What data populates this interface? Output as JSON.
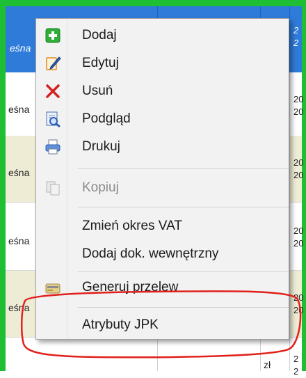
{
  "background": {
    "header_left_text": "eśna",
    "header_right_line1": "2",
    "header_right_line2": "2",
    "rows": [
      {
        "label": "eśna",
        "right1": "20",
        "right2": "20"
      },
      {
        "label": "eśna",
        "right1": "20",
        "right2": "20"
      },
      {
        "label": "eśna",
        "right1": "20",
        "right2": "20"
      },
      {
        "label": "eśna",
        "right1": "20",
        "right2": "20"
      }
    ],
    "bottom_currency": "zł",
    "bottom_right1": "2",
    "bottom_right2": "2",
    "colors": {
      "frame": "#1fbf35",
      "header": "#2f7bd9",
      "alt_row": "#efecd6",
      "highlight_ring": "#e0201b"
    }
  },
  "context_menu": {
    "items": [
      {
        "label": "Dodaj",
        "icon": "add-icon",
        "enabled": true
      },
      {
        "label": "Edytuj",
        "icon": "edit-icon",
        "enabled": true
      },
      {
        "label": "Usuń",
        "icon": "delete-icon",
        "enabled": true
      },
      {
        "label": "Podgląd",
        "icon": "preview-icon",
        "enabled": true
      },
      {
        "label": "Drukuj",
        "icon": "print-icon",
        "enabled": true
      },
      {
        "label": "Kopiuj",
        "icon": "copy-icon",
        "enabled": false
      },
      {
        "label": "Zmień okres VAT",
        "icon": "",
        "enabled": true
      },
      {
        "label": "Dodaj dok. wewnętrzny",
        "icon": "",
        "enabled": true
      },
      {
        "label": "Generuj przelew",
        "icon": "transfer-icon",
        "enabled": true
      },
      {
        "label": "Atrybuty JPK",
        "icon": "",
        "enabled": true
      }
    ]
  }
}
